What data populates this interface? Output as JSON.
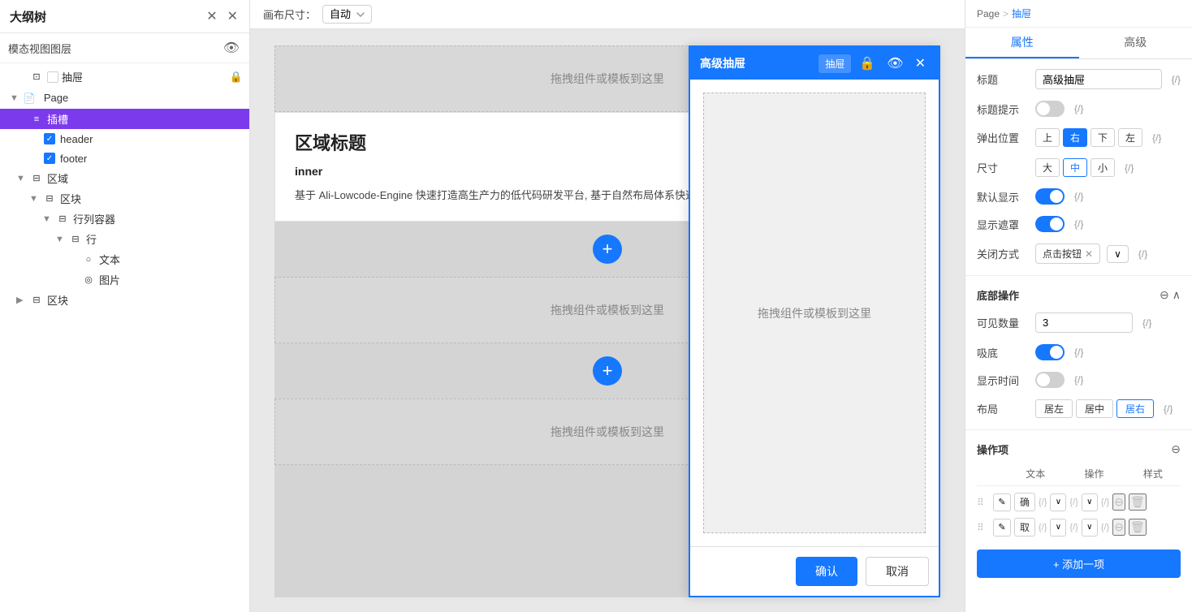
{
  "leftPanel": {
    "title": "大纲树",
    "layerSection": {
      "label": "模态视图图层"
    },
    "tree": {
      "pageNode": "Page",
      "layers": [
        {
          "id": "chou",
          "label": "抽屉",
          "indent": 1,
          "hasCheckbox": true,
          "isLocked": true,
          "isSlot": false
        },
        {
          "id": "page",
          "label": "页面",
          "indent": 0,
          "isGroup": true
        },
        {
          "id": "slot",
          "label": "插槽",
          "indent": 1,
          "isSlotActive": true
        },
        {
          "id": "header",
          "label": "header",
          "indent": 2,
          "hasCheckbox": true
        },
        {
          "id": "footer",
          "label": "footer",
          "indent": 2,
          "hasCheckbox": true
        },
        {
          "id": "area",
          "label": "区域",
          "indent": 1,
          "isGroup": true
        },
        {
          "id": "block1",
          "label": "区块",
          "indent": 2,
          "isGroup": true
        },
        {
          "id": "row-container",
          "label": "行列容器",
          "indent": 3,
          "isGroup": true
        },
        {
          "id": "row",
          "label": "行",
          "indent": 4,
          "isGroup": true
        },
        {
          "id": "text",
          "label": "文本",
          "indent": 5
        },
        {
          "id": "image",
          "label": "图片",
          "indent": 5
        },
        {
          "id": "block2",
          "label": "区块",
          "indent": 1,
          "isGroup": true
        }
      ]
    }
  },
  "canvasToolbar": {
    "sizeLabel": "画布尺寸：",
    "sizeValue": "自动"
  },
  "canvas": {
    "dropZoneText": "拖拽组件或模板到这里",
    "sectionTitle": "区域标题",
    "innerLabel": "inner",
    "contentText": "基于 Ali-Lowcode-Engine 快速打造高生产力的低代码研发平台, 基于自然布局体系快速搭"
  },
  "drawer": {
    "title": "高级抽屉",
    "actionLabel": "抽屉",
    "dropText": "拖拽组件或模板到这里",
    "confirmBtn": "确认",
    "cancelBtn": "取消"
  },
  "rightPanel": {
    "breadcrumb": {
      "parent": "Page",
      "separator": ">",
      "current": "抽屉"
    },
    "tabs": [
      {
        "id": "attrs",
        "label": "属性",
        "active": true
      },
      {
        "id": "advanced",
        "label": "高级",
        "active": false
      }
    ],
    "properties": {
      "title": {
        "label": "标题",
        "value": "高级抽屉",
        "codeBtn": "{/}"
      },
      "titleTip": {
        "label": "标题提示",
        "toggleOn": false,
        "codeBtn": "{/}"
      },
      "popupPos": {
        "label": "弹出位置",
        "options": [
          "上",
          "右",
          "下",
          "左"
        ],
        "active": "右",
        "codeBtn": "{/}"
      },
      "size": {
        "label": "尺寸",
        "options": [
          "大",
          "中",
          "小"
        ],
        "active": "中",
        "codeBtn": "{/}"
      },
      "defaultShow": {
        "label": "默认显示",
        "toggleOn": true,
        "codeBtn": "{/}"
      },
      "showMask": {
        "label": "显示遮罩",
        "toggleOn": true,
        "codeBtn": "{/}"
      },
      "closeMode": {
        "label": "关闭方式",
        "tagValue": "点击按钮",
        "codeBtn": "{/}"
      }
    },
    "bottomOps": {
      "sectionTitle": "底部操作",
      "visibleCount": {
        "label": "可见数量",
        "value": "3",
        "codeBtn": "{/}"
      },
      "stickyBottom": {
        "label": "吸底",
        "toggleOn": true,
        "codeBtn": "{/}"
      },
      "showTime": {
        "label": "显示时间",
        "toggleOn": false,
        "codeBtn": "{/}"
      },
      "layout": {
        "label": "布局",
        "options": [
          "居左",
          "居中",
          "居右"
        ],
        "active": "居右",
        "codeBtn": "{/}"
      }
    },
    "actionItems": {
      "sectionTitle": "操作项",
      "tableHeaders": {
        "text": "文本",
        "action": "操作",
        "style": "样式"
      },
      "rows": [
        {
          "id": "confirm-row",
          "text": "确",
          "action": "{/}",
          "style": "{/}"
        },
        {
          "id": "cancel-row",
          "text": "取",
          "action": "{/}",
          "style": "{/}"
        }
      ],
      "addBtn": "+ 添加一项"
    }
  }
}
